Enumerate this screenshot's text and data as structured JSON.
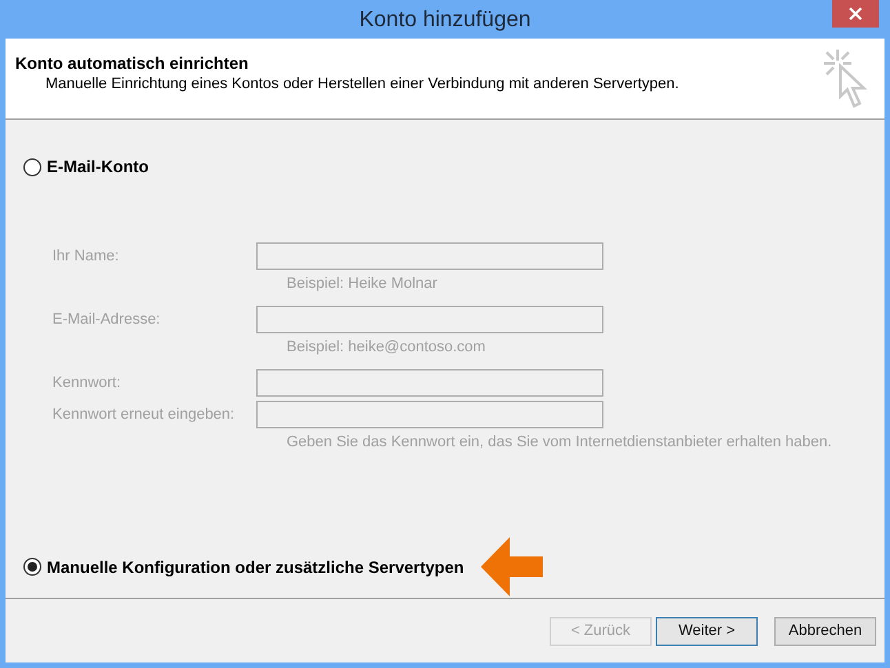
{
  "window": {
    "title": "Konto hinzufügen"
  },
  "header": {
    "title": "Konto automatisch einrichten",
    "subtitle": "Manuelle Einrichtung eines Kontos oder Herstellen einer Verbindung mit anderen Servertypen."
  },
  "options": [
    {
      "label": "E-Mail-Konto",
      "selected": false
    },
    {
      "label": "Manuelle Konfiguration oder zusätzliche Servertypen",
      "selected": true
    }
  ],
  "form": {
    "disabled": true,
    "fields": [
      {
        "label": "Ihr Name:",
        "hint": "Beispiel: Heike Molnar"
      },
      {
        "label": "E-Mail-Adresse:",
        "hint": "Beispiel: heike@contoso.com"
      },
      {
        "label": "Kennwort:"
      },
      {
        "label": "Kennwort erneut eingeben:",
        "hint": "Geben Sie das Kennwort ein, das Sie vom Internetdienstanbieter erhalten haben."
      }
    ]
  },
  "buttons": [
    {
      "label": "< Zurück",
      "disabled": true,
      "default": false
    },
    {
      "label": "Weiter >",
      "disabled": false,
      "default": true
    },
    {
      "label": "Abbrechen",
      "disabled": false,
      "default": false
    }
  ]
}
